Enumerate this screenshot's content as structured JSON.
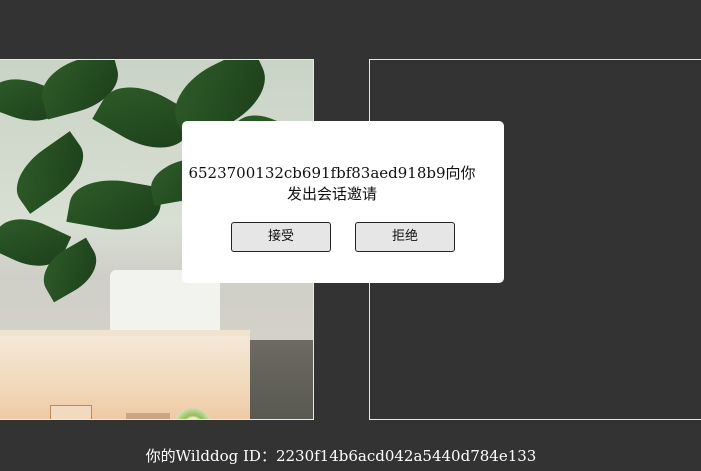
{
  "dialog": {
    "message": "6523700132cb691fbf83aed918b9向你发出会话邀请",
    "accept_label": "接受",
    "reject_label": "拒绝"
  },
  "footer": {
    "id_text": "你的Wilddog ID：2230f14b6acd042a5440d784e133"
  },
  "colors": {
    "background": "#333333",
    "panel_border": "#e8e8e8",
    "dialog_background": "#ffffff",
    "button_background": "#e6e6e6"
  }
}
